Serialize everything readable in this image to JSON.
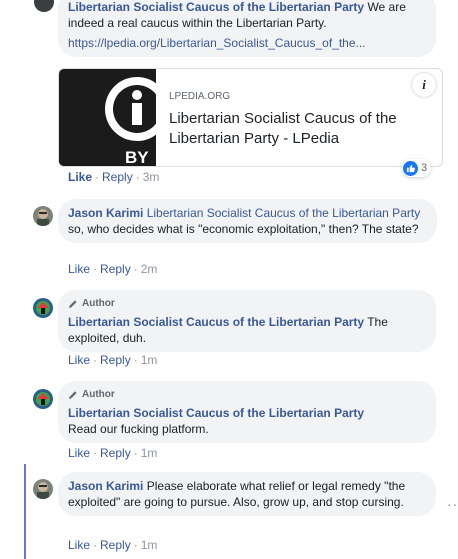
{
  "comments": [
    {
      "author": "Libertarian Socialist Caucus of the Libertarian Party",
      "text": "We are indeed a real caucus within the Libertarian Party.",
      "link": "https://lpedia.org/Libertarian_Socialist_Caucus_of_the...",
      "preview": {
        "domain": "LPEDIA.ORG",
        "title": "Libertarian Socialist Caucus of the Libertarian Party - LPedia",
        "thumb_text": "BY"
      },
      "reaction_count": "3",
      "like": "Like",
      "reply": "Reply",
      "time": "3m"
    },
    {
      "author": "Jason Karimi",
      "tag": "Libertarian Socialist Caucus of the Libertarian Party",
      "text": "so, who decides what is \"economic exploitation,\" then? The state?",
      "like": "Like",
      "reply": "Reply",
      "time": "2m"
    },
    {
      "badge": "Author",
      "author": "Libertarian Socialist Caucus of the Libertarian Party",
      "text": "The exploited, duh.",
      "like": "Like",
      "reply": "Reply",
      "time": "1m"
    },
    {
      "badge": "Author",
      "author": "Libertarian Socialist Caucus of the Libertarian Party",
      "text": "Read our fucking platform.",
      "like": "Like",
      "reply": "Reply",
      "time": "1m"
    },
    {
      "author": "Jason Karimi",
      "text": "Please elaborate what relief or legal remedy \"the exploited\" are going to pursue. Also, grow up, and stop cursing.",
      "like": "Like",
      "reply": "Reply",
      "time": "1m"
    }
  ],
  "colors": {
    "name": "#385898",
    "bubble": "#f2f3f5",
    "like_blue": "#1877f2",
    "thread_line": "#5b7bd5"
  },
  "icons": [
    "avatar-lsc",
    "avatar-jason",
    "pencil-icon",
    "info-icon",
    "like-reaction-icon",
    "more-dots-icon"
  ],
  "more_label": "···"
}
